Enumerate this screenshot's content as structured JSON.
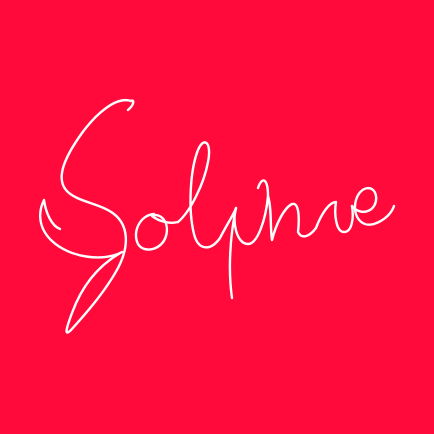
{
  "logo": {
    "wordmark": "Solvne",
    "background_color": "#ff0a3b",
    "ink_color": "#ffffff"
  }
}
